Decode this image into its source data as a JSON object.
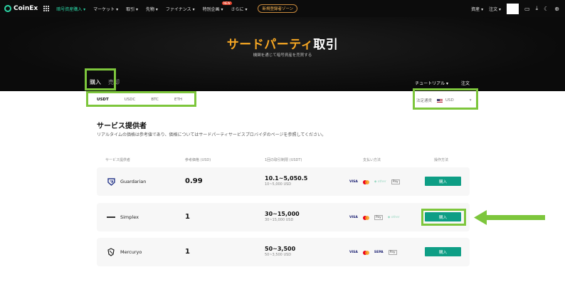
{
  "nav": {
    "brand": "CoinEx",
    "items": [
      {
        "label": "暗号資産購入 ▾",
        "active": true
      },
      {
        "label": "マーケット ▾"
      },
      {
        "label": "取引 ▾"
      },
      {
        "label": "先物 ▾"
      },
      {
        "label": "ファイナンス ▾"
      },
      {
        "label": "特別企画 ▾",
        "badge": "NEW"
      },
      {
        "label": "さらに ▾"
      }
    ],
    "promo": "新規登録者ゾーン",
    "right": {
      "assets": "資産 ▾",
      "orders": "注文 ▾"
    }
  },
  "hero": {
    "title_accent": "サードパーティ",
    "title_rest": "取引",
    "subtitle": "機関を通じて暗号資産を売買する",
    "tabs": {
      "buy": "購入",
      "sell": "売却"
    },
    "tutorial": "チュートリアル ▾",
    "orders": "注文"
  },
  "coins": [
    "USDT",
    "USDC",
    "BTC",
    "ETH"
  ],
  "fiat": {
    "label": "法定通貨",
    "currency": "USD",
    "chevron": "▾"
  },
  "section": {
    "title": "サービス提供者",
    "description": "リアルタイムの価格は参考値であり、価格についてはサードパーティサービスプロバイダのページを参照してください。"
  },
  "table": {
    "headers": {
      "provider": "サービス提供者",
      "price": "参考価格 (USD)",
      "limit": "1回の取引制限 (USDT)",
      "pay": "支払い方法",
      "action": "操作方法"
    },
    "rows": [
      {
        "name": "Guardarian",
        "price": "0.99",
        "limit_main": "10.1~5,050.5",
        "limit_sub": "10~5,000 USD",
        "button": "購入"
      },
      {
        "name": "Simplex",
        "price": "1",
        "limit_main": "30~15,000",
        "limit_sub": "30~15,000 USD",
        "button": "購入"
      },
      {
        "name": "Mercuryo",
        "price": "1",
        "limit_main": "50~3,500",
        "limit_sub": "50~3,500 USD",
        "button": "購入"
      }
    ],
    "payments": {
      "visa": "VISA",
      "apay": "Pay",
      "gpay": "Pay",
      "sepa": "SEPA",
      "lite": "◆ other"
    }
  },
  "colors": {
    "accent": "#2bd6a6",
    "button": "#0e9e85",
    "highlight": "#7dc63c",
    "title_accent": "#f5a623"
  }
}
